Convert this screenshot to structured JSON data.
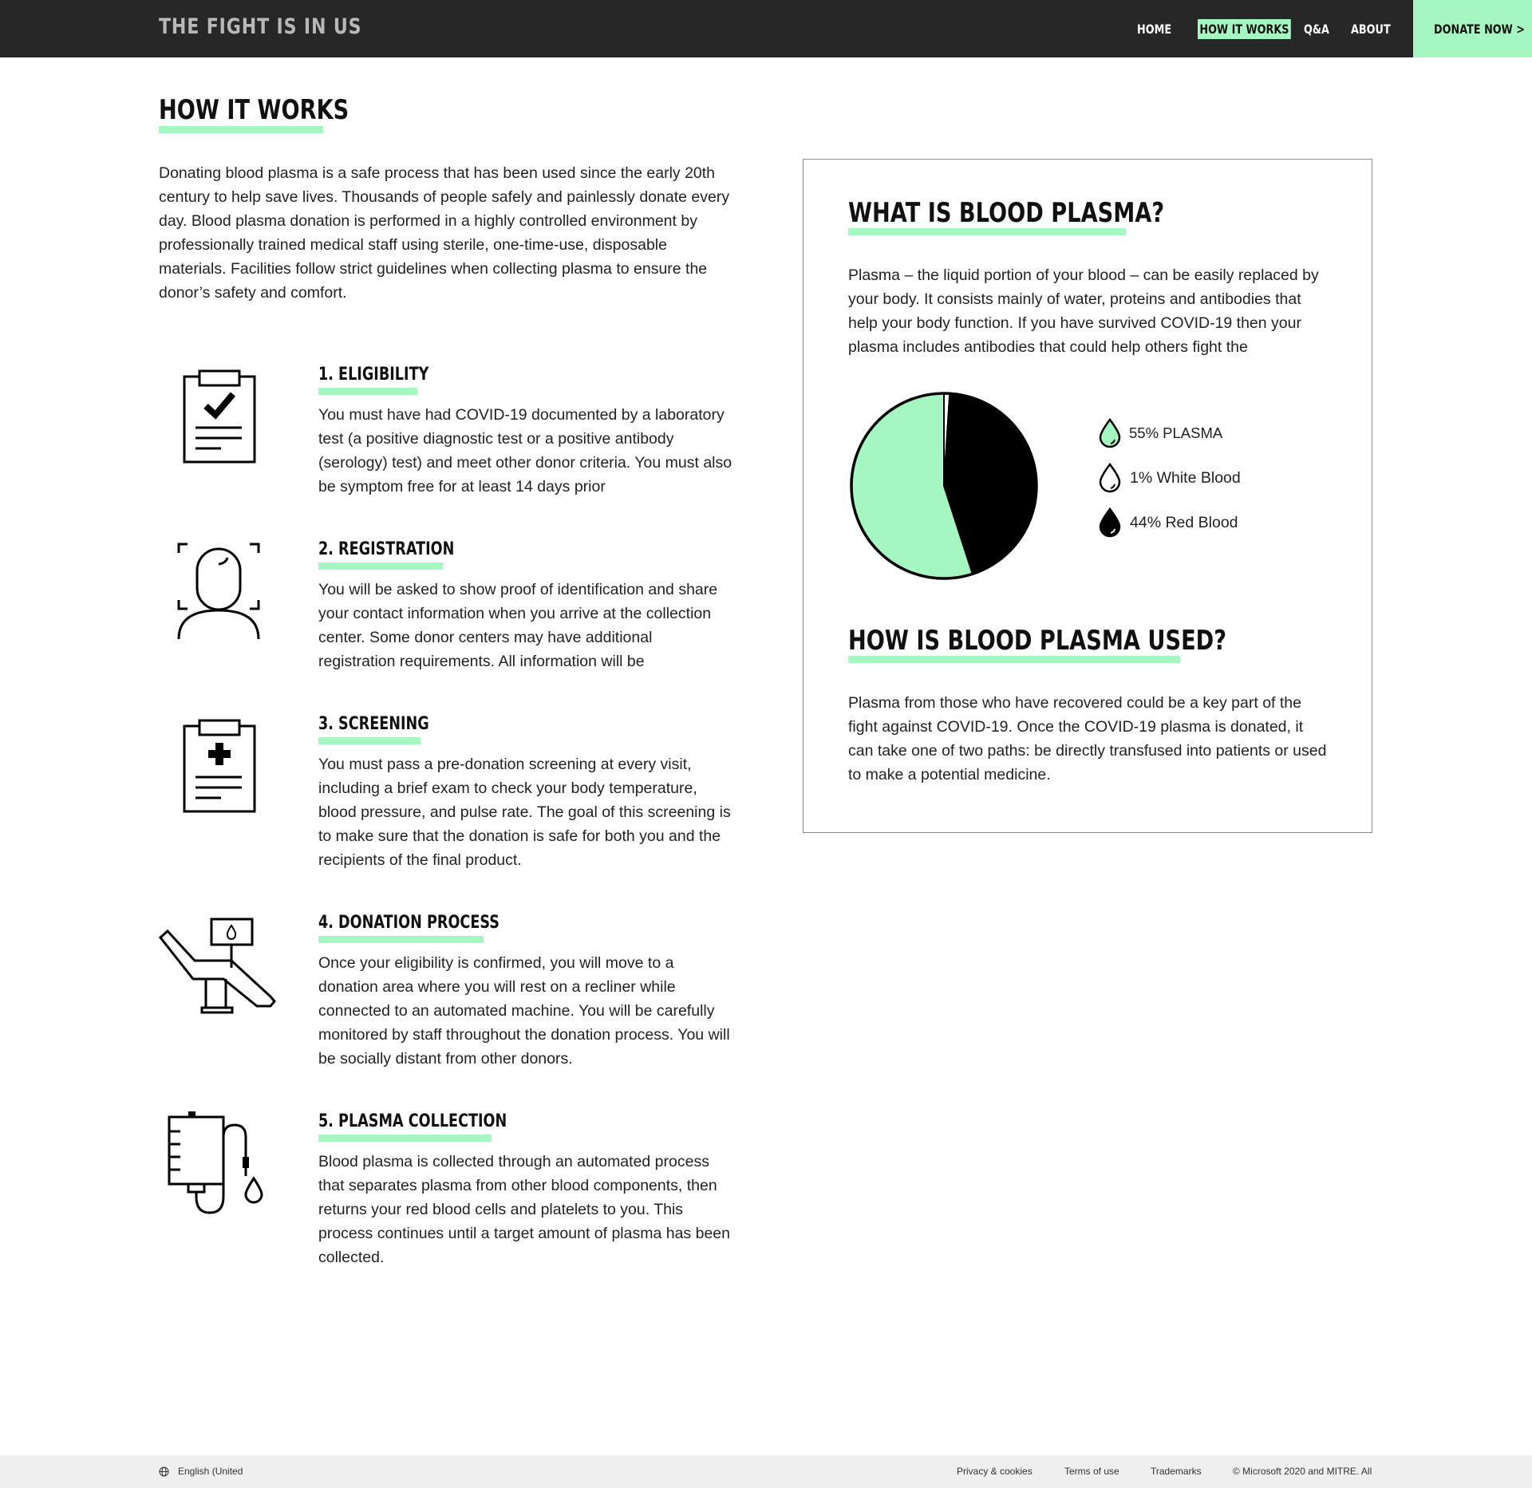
{
  "header": {
    "brand": "THE FIGHT IS IN US",
    "nav": {
      "home": "HOME",
      "how_it_works": "HOW IT WORKS",
      "qa": "Q&A",
      "about": "ABOUT"
    },
    "donate": "DONATE NOW >",
    "active_color": "#a5f6c1"
  },
  "main": {
    "title": "HOW IT WORKS",
    "intro": "Donating blood plasma is a safe process that has been used since the early 20th century to help save lives. Thousands of people safely and painlessly donate every day. Blood plasma donation is performed in a highly controlled environment by professionally trained medical staff using sterile, one-time-use, disposable materials. Facilities follow strict guidelines when collecting plasma to ensure the donor’s safety and comfort.",
    "steps": [
      {
        "title": "1. ELIGIBILITY",
        "text": "You must have had COVID-19 documented by a laboratory test (a positive diagnostic test or a positive antibody (serology) test) and meet other donor criteria. You must also be symptom free for at least 14 days prior",
        "icon": "clipboard-check-icon"
      },
      {
        "title": "2. REGISTRATION",
        "text": "You will be asked to show proof of identification and share your contact information when you arrive at the collection center. Some donor centers may have additional registration requirements. All information will be",
        "icon": "face-scan-icon"
      },
      {
        "title": "3. SCREENING",
        "text": "You must pass a pre-donation screening at every visit, including a brief exam to check your body temperature, blood pressure, and pulse rate. The goal of this screening is to make sure that the donation is safe for both you and the recipients of the final product.",
        "icon": "clipboard-medical-icon"
      },
      {
        "title": "4. DONATION PROCESS",
        "text": "Once your eligibility is confirmed, you will move to a donation area where you will rest on a recliner while connected to an automated machine. You will be carefully monitored by staff throughout the donation process. You will be socially distant from other donors.",
        "icon": "donation-chair-icon"
      },
      {
        "title": "5. PLASMA COLLECTION",
        "text": "Blood plasma is collected through an automated process that separates plasma from other blood components, then returns your red blood cells and platelets to you. This process continues until a target amount of plasma has been collected.",
        "icon": "plasma-bag-icon"
      }
    ]
  },
  "info": {
    "plasma_title": "WHAT IS BLOOD PLASMA?",
    "plasma_text": "Plasma – the liquid portion of your blood – can be easily replaced by your body. It consists mainly of water, proteins and antibodies that help your body function. If you have survived COVID-19 then your plasma includes antibodies that could help others fight the",
    "legend": [
      {
        "label": "55% PLASMA",
        "icon": "drop-green-icon"
      },
      {
        "label": "1% White Blood",
        "icon": "drop-white-icon"
      },
      {
        "label": "44% Red Blood",
        "icon": "drop-black-icon"
      }
    ],
    "used_title": "HOW IS BLOOD PLASMA USED?",
    "used_text": "Plasma from those who have recovered could be a key part of the fight against COVID-19. Once the COVID-19 plasma is donated, it can take one of two paths: be directly transfused into patients or used to make a potential medicine."
  },
  "chart_data": {
    "type": "pie",
    "title": "",
    "slices": [
      {
        "label": "55% PLASMA",
        "value": 55,
        "color": "#a5f6c1"
      },
      {
        "label": "1% White Blood",
        "value": 1,
        "color": "#ffffff"
      },
      {
        "label": "44% Red Blood",
        "value": 44,
        "color": "#000000"
      }
    ]
  },
  "footer": {
    "language": "English (United",
    "privacy": "Privacy & cookies",
    "terms": "Terms of use",
    "trademarks": "Trademarks",
    "copyright": "© Microsoft 2020 and MITRE. All"
  }
}
